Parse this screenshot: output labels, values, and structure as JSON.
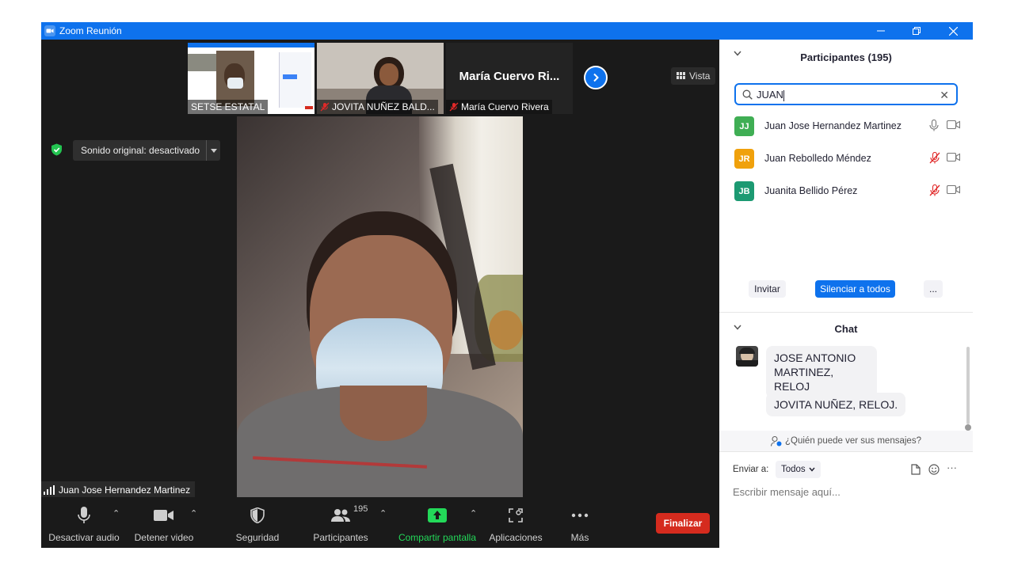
{
  "window": {
    "title": "Zoom Reunión",
    "controls": [
      "minimize",
      "restore",
      "close"
    ]
  },
  "thumbnails": [
    {
      "label": "SETSE ESTATAL",
      "muted": false
    },
    {
      "label": "JOVITA NUÑEZ BALD...",
      "muted": true
    },
    {
      "label": "María Cuervo Rivera",
      "display_name": "María Cuervo Ri...",
      "muted": true
    }
  ],
  "view_button": "Vista",
  "original_sound": "Sonido original: desactivado",
  "active_speaker": "Juan Jose Hernandez Martinez",
  "toolbar": {
    "mute_audio": "Desactivar audio",
    "stop_video": "Detener video",
    "security": "Seguridad",
    "participants": "Participantes",
    "participants_count": "195",
    "share_screen": "Compartir pantalla",
    "apps": "Aplicaciones",
    "more": "Más",
    "end": "Finalizar"
  },
  "participants_panel": {
    "title": "Participantes (195)",
    "search_value": "JUAN",
    "items": [
      {
        "initials": "JJ",
        "name": "Juan Jose Hernandez Martinez",
        "color": "#3fae54",
        "muted": false
      },
      {
        "initials": "JR",
        "name": "Juan Rebolledo Méndez",
        "color": "#f0a10c",
        "muted": true
      },
      {
        "initials": "JB",
        "name": "Juanita Bellido Pérez",
        "color": "#1c9a72",
        "muted": true
      }
    ],
    "invite": "Invitar",
    "mute_all": "Silenciar a todos",
    "more": "..."
  },
  "chat": {
    "title": "Chat",
    "messages": [
      "JOSE ANTONIO MARTINEZ, RELOJ",
      "JOVITA NUÑEZ, RELOJ."
    ],
    "who_can_see": "¿Quién puede ver sus mensajes?",
    "send_to_label": "Enviar a:",
    "send_to_value": "Todos",
    "placeholder": "Escribir mensaje aquí...",
    "more": "···"
  },
  "colors": {
    "zoom_blue": "#0e72ed",
    "end_red": "#d52b1e",
    "share_green": "#23d959",
    "muted_red": "#e02828"
  }
}
